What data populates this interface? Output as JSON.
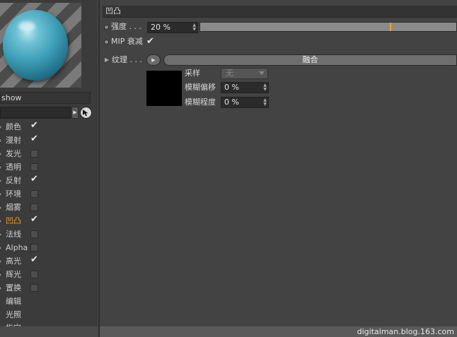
{
  "material": {
    "name": "show"
  },
  "channels": [
    {
      "label": "颜色",
      "checked": true,
      "active": false,
      "has_checkbox": true
    },
    {
      "label": "漫射",
      "checked": true,
      "active": false,
      "has_checkbox": true
    },
    {
      "label": "发光",
      "checked": false,
      "active": false,
      "has_checkbox": true
    },
    {
      "label": "透明",
      "checked": false,
      "active": false,
      "has_checkbox": true
    },
    {
      "label": "反射",
      "checked": true,
      "active": false,
      "has_checkbox": true
    },
    {
      "label": "环境",
      "checked": false,
      "active": false,
      "has_checkbox": true
    },
    {
      "label": "烟雾",
      "checked": false,
      "active": false,
      "has_checkbox": true
    },
    {
      "label": "凹凸",
      "checked": true,
      "active": true,
      "has_checkbox": true
    },
    {
      "label": "法线",
      "checked": false,
      "active": false,
      "has_checkbox": true
    },
    {
      "label": "Alpha",
      "checked": false,
      "active": false,
      "has_checkbox": true
    },
    {
      "label": "高光",
      "checked": true,
      "active": false,
      "has_checkbox": true
    },
    {
      "label": "辉光",
      "checked": false,
      "active": false,
      "has_checkbox": true
    },
    {
      "label": "置换",
      "checked": false,
      "active": false,
      "has_checkbox": true
    },
    {
      "label": "编辑",
      "checked": false,
      "active": false,
      "has_checkbox": false
    },
    {
      "label": "光照",
      "checked": false,
      "active": false,
      "has_checkbox": false
    },
    {
      "label": "指定",
      "checked": false,
      "active": false,
      "has_checkbox": false
    }
  ],
  "panel": {
    "title": "凹凸",
    "strength": {
      "label": "强度 . . .",
      "value": "20 %",
      "fraction": 0.2
    },
    "mip": {
      "label": "MIP 衰减",
      "checked": true
    },
    "texture": {
      "label": "纹理 . . .",
      "button": "融合"
    },
    "sampling": {
      "label": "采样",
      "value": "无"
    },
    "blur_offset": {
      "label": "模糊偏移",
      "value": "0 %"
    },
    "blur_degree": {
      "label": "模糊程度",
      "value": "0 %"
    }
  },
  "watermark": "digitalman.blog.163.com",
  "colors": {
    "accent": "#f0a030",
    "background": "#434343",
    "sidebar": "#3b3b3b"
  }
}
